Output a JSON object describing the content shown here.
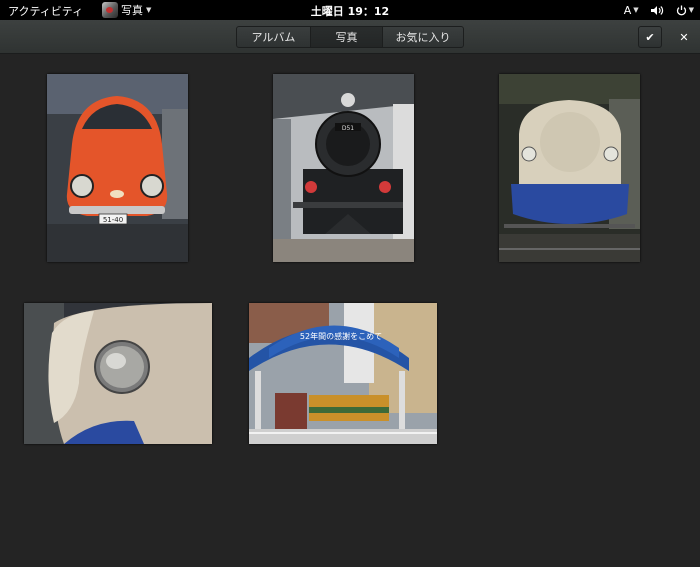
{
  "topbar": {
    "activities": "アクティビティ",
    "app_name": "写真",
    "clock": "土曜日 19：12",
    "input_method": "A"
  },
  "header": {
    "tabs": [
      {
        "label": "アルバム"
      },
      {
        "label": "写真"
      },
      {
        "label": "お気に入り"
      }
    ],
    "active_tab": "写真"
  },
  "photos": [
    {
      "subject": "orange-car",
      "plate": "51-40"
    },
    {
      "subject": "steam-locomotive",
      "plate": "D51"
    },
    {
      "subject": "shinkansen-front"
    },
    {
      "subject": "shinkansen-nose-closeup"
    },
    {
      "subject": "railway-exhibition-gate",
      "banner": "52年間の感謝をこめて"
    }
  ]
}
